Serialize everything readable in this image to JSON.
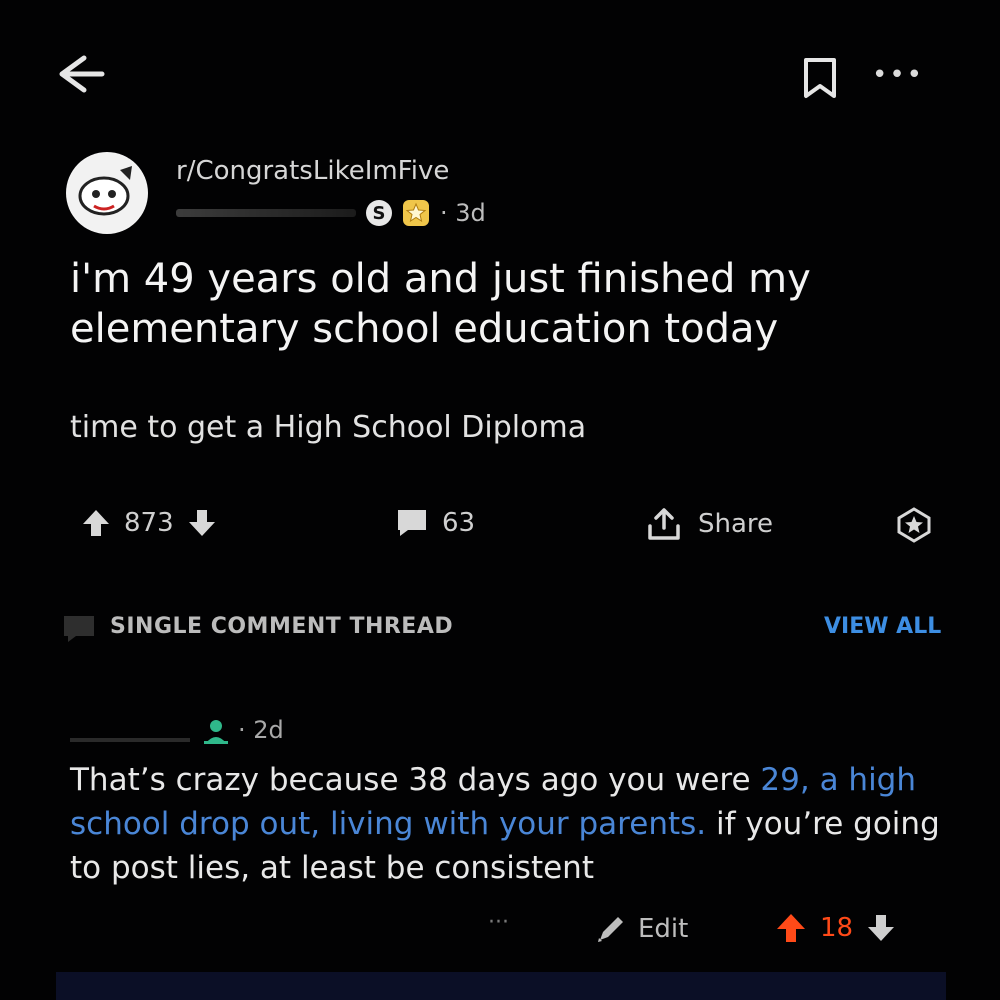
{
  "post": {
    "subreddit": "r/CongratsLikeImFive",
    "time": "3d",
    "title": "i'm 49 years old and just finished my elementary school education today",
    "body": "time to get a High School Diploma",
    "upvotes": "873",
    "comments": "63",
    "share_label": "Share"
  },
  "thread": {
    "label": "SINGLE COMMENT THREAD",
    "view_all": "VIEW ALL"
  },
  "comment": {
    "time": "2d",
    "text_before": "That’s crazy because 38 days ago you were ",
    "link_text": "29, a high school drop out, living with your parents.",
    "text_after": " if you’re going to post lies, at least be consistent",
    "more": "···",
    "edit_label": "Edit",
    "score": "18"
  },
  "colors": {
    "background": "#020203",
    "link": "#4a86d6",
    "view_all": "#3d8ee3",
    "upvoted": "#ff4a18",
    "badge_gold": "#f0c64a"
  }
}
